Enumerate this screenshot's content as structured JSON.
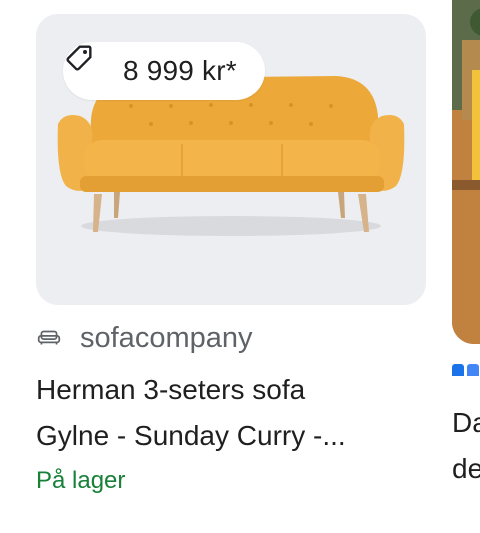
{
  "product": {
    "price": "8 999 kr*",
    "store": "sofacompany",
    "title_line1": "Herman 3-seters sofa",
    "title_line2": "Gylne - Sunday Curry -...",
    "stock": "På lager",
    "sofa_color": "#f0ad3e",
    "stock_color": "#188038"
  },
  "next_product": {
    "title_line1": "Da",
    "title_line2": "de"
  },
  "icons": {
    "price": "tag-icon",
    "store": "sofa-icon"
  }
}
